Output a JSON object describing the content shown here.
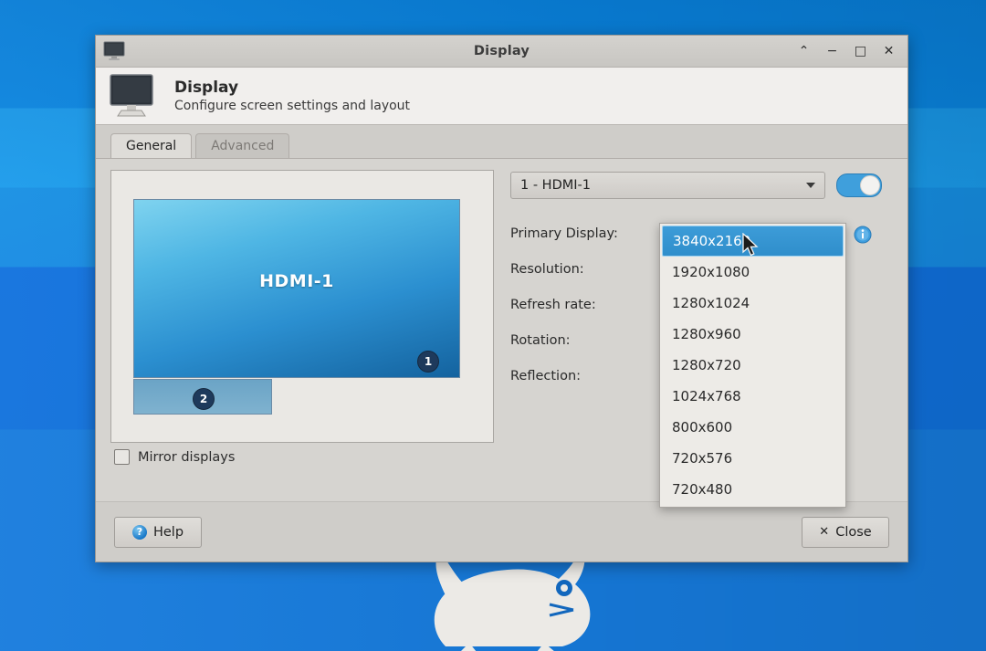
{
  "window": {
    "title": "Display",
    "icon": "monitor-icon",
    "controls": {
      "shade": "⌃",
      "minimize": "−",
      "maximize": "□",
      "close": "✕"
    }
  },
  "header": {
    "title": "Display",
    "subtitle": "Configure screen settings and layout",
    "icon": "monitor-large-icon"
  },
  "tabs": [
    {
      "label": "General",
      "active": true
    },
    {
      "label": "Advanced",
      "active": false
    }
  ],
  "preview": {
    "display1": {
      "label": "HDMI-1",
      "badge": "1"
    },
    "display2": {
      "label": "",
      "badge": "2"
    }
  },
  "mirror": {
    "label": "Mirror displays",
    "checked": false
  },
  "output_selector": {
    "value": "1 - HDMI-1",
    "enabled": true
  },
  "fields": [
    {
      "label": "Primary Display:"
    },
    {
      "label": "Resolution:"
    },
    {
      "label": "Refresh rate:"
    },
    {
      "label": "Rotation:"
    },
    {
      "label": "Reflection:"
    }
  ],
  "resolution_dropdown": {
    "open": true,
    "selected": "3840x2160",
    "options": [
      "3840x2160",
      "1920x1080",
      "1280x1024",
      "1280x960",
      "1280x720",
      "1024x768",
      "800x600",
      "720x576",
      "720x480"
    ]
  },
  "info_icon": "info-icon",
  "footer": {
    "help_label": "Help",
    "help_glyph": "?",
    "close_label": "Close",
    "close_glyph": "✕"
  },
  "desktop": {
    "logo": "xfce-mouse-logo",
    "accent_blue": "#1277d4",
    "highlight_blue": "#3d9cd8"
  }
}
